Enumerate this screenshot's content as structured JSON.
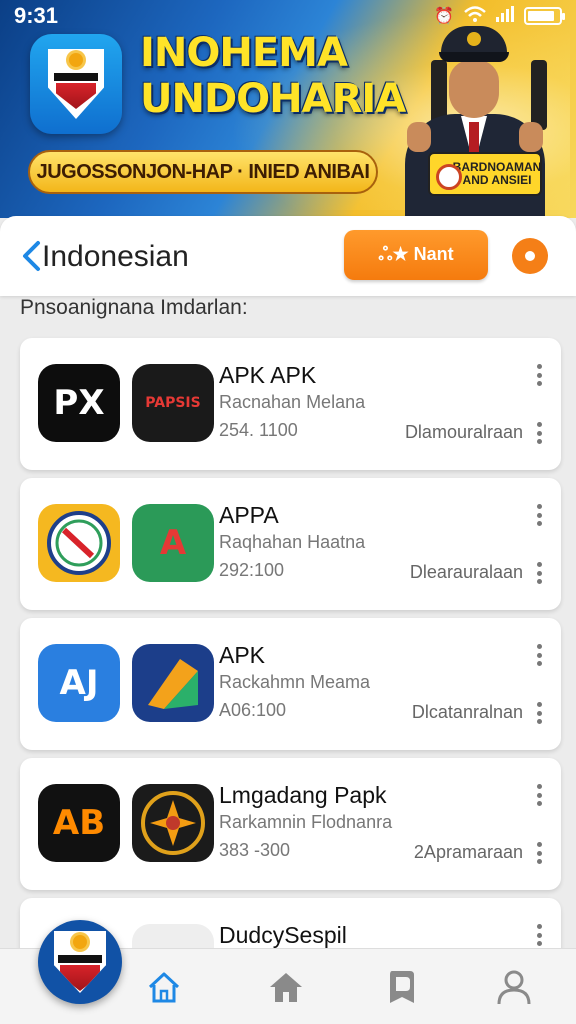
{
  "status_bar": {
    "time": "9:31",
    "battery_level": 0.85
  },
  "banner": {
    "title": "INOHEMA UNDOHARIA",
    "subtitle": "JUGOSSONJON-HAP · INIED ANIBAI",
    "sign_text": "BARDNOAMAN AND ANSIEI"
  },
  "header": {
    "title": "Indonesian",
    "action_label": "ஃ★ Nant"
  },
  "section_label": "Pnsoanignana Imdarlan:",
  "apps": [
    {
      "name": "APK APK",
      "developer": "Racnahan Melana",
      "downloads": "254. 1100",
      "status": "Dlamouralraan",
      "icon_a": {
        "text": "PX",
        "bg": "#0d0d0d",
        "color": "#ffffff",
        "name": "px-app-icon"
      },
      "icon_b": {
        "text": "PAPSIS",
        "bg": "#1a1a1a",
        "color": "#e53935",
        "name": "papsis-app-icon"
      }
    },
    {
      "name": "APPA",
      "developer": "Raqhahan Haatna",
      "downloads": "292:100",
      "status": "Dlearauralaan",
      "icon_a": {
        "text": "",
        "bg": "#f5b820",
        "color": "#1e3f8a",
        "name": "compass-badge-icon"
      },
      "icon_b": {
        "text": "A",
        "bg": "#2b9a58",
        "color": "#e53935",
        "name": "letter-a-icon"
      }
    },
    {
      "name": "APK",
      "developer": "Rackahmn Meama",
      "downloads": "A06:100",
      "status": "Dlcatanralnan",
      "icon_a": {
        "text": "AJ",
        "bg": "#2a7fe0",
        "color": "#ffffff",
        "name": "aj-app-icon"
      },
      "icon_b": {
        "text": "",
        "bg": "#1c3e8a",
        "color": "#f3a21b",
        "name": "arrow-logo-icon"
      }
    },
    {
      "name": "Lmgadang Papk",
      "developer": "Rarkamnin Flodnanra",
      "downloads": "383 -300",
      "status": "2Apramaraan",
      "icon_a": {
        "text": "AB",
        "bg": "#111111",
        "color": "#ff8a00",
        "name": "ab-app-icon"
      },
      "icon_b": {
        "text": "",
        "bg": "#1b1b1b",
        "color": "#f39c12",
        "name": "emblem-app-icon"
      }
    },
    {
      "name": "DudcySespil",
      "developer": "",
      "downloads": "",
      "status": "",
      "icon_a": {
        "text": "",
        "bg": "#ffffff",
        "color": "#000000",
        "name": "partial-icon"
      },
      "icon_b": {
        "text": "",
        "bg": "#eeeeee",
        "color": "#333333",
        "name": "partial-icon-2"
      }
    }
  ],
  "colors": {
    "accent": "#1e88e5",
    "orange": "#f57b0e",
    "nav_icon": "#8a8a8a"
  },
  "nav_icons": [
    "home-outline-icon",
    "home-filled-icon",
    "bookmark-icon",
    "profile-icon"
  ]
}
